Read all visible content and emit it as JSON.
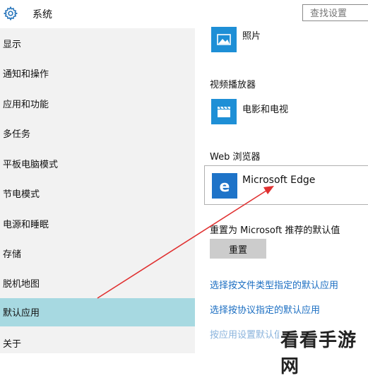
{
  "header": {
    "title": "系统",
    "search_placeholder": "查找设置"
  },
  "sidebar": {
    "items": [
      {
        "label": "显示"
      },
      {
        "label": "通知和操作"
      },
      {
        "label": "应用和功能"
      },
      {
        "label": "多任务"
      },
      {
        "label": "平板电脑模式"
      },
      {
        "label": "节电模式"
      },
      {
        "label": "电源和睡眠"
      },
      {
        "label": "存储"
      },
      {
        "label": "脱机地图"
      },
      {
        "label": "默认应用",
        "active": true
      },
      {
        "label": "关于"
      }
    ]
  },
  "main": {
    "photo_app": "照片",
    "video_section": "视频播放器",
    "video_app": "电影和电视",
    "web_section": "Web 浏览器",
    "web_app": "Microsoft Edge",
    "reset_label": "重置为 Microsoft 推荐的默认值",
    "reset_button": "重置",
    "link_filetype": "选择按文件类型指定的默认应用",
    "link_protocol": "选择按协议指定的默认应用",
    "link_app_defaults": "按应用设置默认值"
  },
  "watermark": "看看手游网",
  "colors": {
    "accent": "#1e8fd6",
    "active_nav": "#a7d9e1",
    "link": "#1b6ec2",
    "annotation_arrow": "#e03030"
  }
}
